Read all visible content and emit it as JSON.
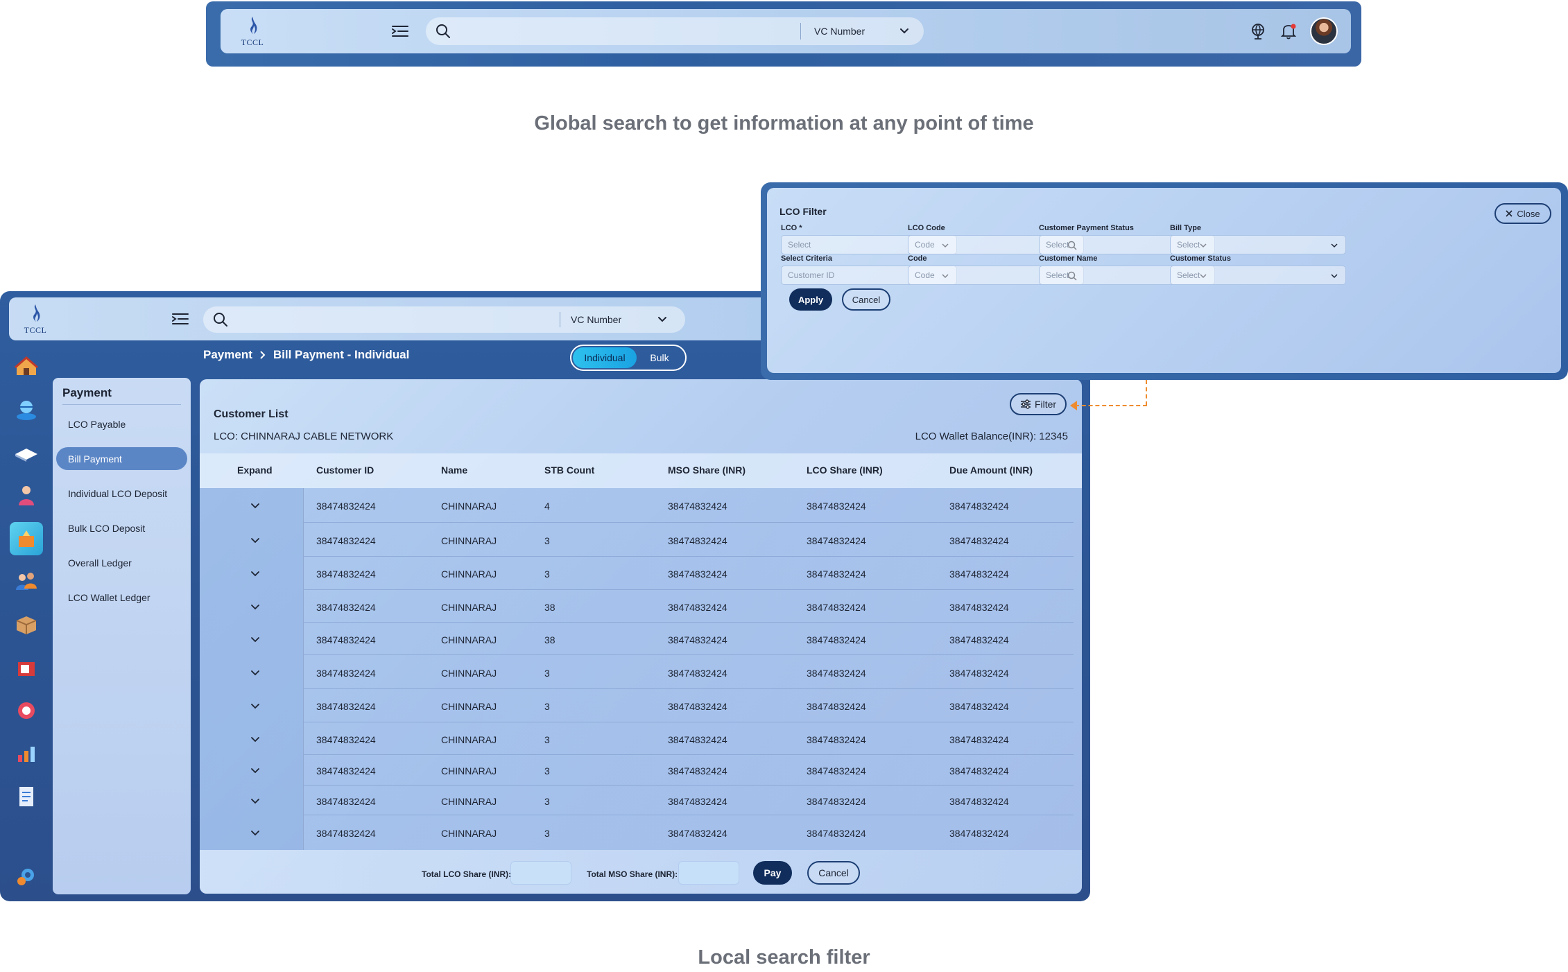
{
  "top_bar": {
    "logo_text": "TCCL",
    "search_placeholder": "",
    "search_type": "VC Number"
  },
  "captions": {
    "global": "Global search to get information at any point of time",
    "local": "Local search filter"
  },
  "app": {
    "logo_text": "TCCL",
    "search_type": "VC Number",
    "breadcrumb": {
      "parent": "Payment",
      "current": "Bill Payment - Individual"
    },
    "toggle": {
      "individual": "Individual",
      "bulk": "Bulk"
    },
    "sidebar": {
      "title": "Payment",
      "items": [
        {
          "label": "LCO Payable"
        },
        {
          "label": "Bill Payment"
        },
        {
          "label": "Individual LCO Deposit"
        },
        {
          "label": "Bulk LCO Deposit"
        },
        {
          "label": "Overall Ledger"
        },
        {
          "label": "LCO Wallet Ledger"
        }
      ]
    },
    "customer_list": {
      "title": "Customer List",
      "lco_label": "LCO: CHINNARAJ CABLE NETWORK",
      "wallet_balance": "LCO Wallet Balance(INR): 12345",
      "filter_label": "Filter",
      "columns": [
        "Expand",
        "Customer ID",
        "Name",
        "STB Count",
        "MSO Share (INR)",
        "LCO Share (INR)",
        "Due Amount (INR)"
      ],
      "rows": [
        {
          "id": "38474832424",
          "name": "CHINNARAJ",
          "stb": "4",
          "mso": "38474832424",
          "lco": "38474832424",
          "due": "38474832424"
        },
        {
          "id": "38474832424",
          "name": "CHINNARAJ",
          "stb": "3",
          "mso": "38474832424",
          "lco": "38474832424",
          "due": "38474832424"
        },
        {
          "id": "38474832424",
          "name": "CHINNARAJ",
          "stb": "3",
          "mso": "38474832424",
          "lco": "38474832424",
          "due": "38474832424"
        },
        {
          "id": "38474832424",
          "name": "CHINNARAJ",
          "stb": "38",
          "mso": "38474832424",
          "lco": "38474832424",
          "due": "38474832424"
        },
        {
          "id": "38474832424",
          "name": "CHINNARAJ",
          "stb": "38",
          "mso": "38474832424",
          "lco": "38474832424",
          "due": "38474832424"
        },
        {
          "id": "38474832424",
          "name": "CHINNARAJ",
          "stb": "3",
          "mso": "38474832424",
          "lco": "38474832424",
          "due": "38474832424"
        },
        {
          "id": "38474832424",
          "name": "CHINNARAJ",
          "stb": "3",
          "mso": "38474832424",
          "lco": "38474832424",
          "due": "38474832424"
        },
        {
          "id": "38474832424",
          "name": "CHINNARAJ",
          "stb": "3",
          "mso": "38474832424",
          "lco": "38474832424",
          "due": "38474832424"
        },
        {
          "id": "38474832424",
          "name": "CHINNARAJ",
          "stb": "3",
          "mso": "38474832424",
          "lco": "38474832424",
          "due": "38474832424"
        },
        {
          "id": "38474832424",
          "name": "CHINNARAJ",
          "stb": "3",
          "mso": "38474832424",
          "lco": "38474832424",
          "due": "38474832424"
        },
        {
          "id": "38474832424",
          "name": "CHINNARAJ",
          "stb": "3",
          "mso": "38474832424",
          "lco": "38474832424",
          "due": "38474832424"
        }
      ],
      "footer": {
        "total_lco_label": "Total LCO Share (INR):",
        "total_lco_value": "",
        "total_mso_label": "Total MSO Share (INR):",
        "total_mso_value": "",
        "pay_label": "Pay",
        "cancel_label": "Cancel"
      }
    }
  },
  "lco_filter": {
    "title": "LCO Filter",
    "close_label": "Close",
    "fields": [
      {
        "label": "LCO *",
        "placeholder": "Select",
        "kind": "select"
      },
      {
        "label": "LCO Code",
        "placeholder": "Code",
        "kind": "search"
      },
      {
        "label": "Customer Payment Status",
        "placeholder": "Select",
        "kind": "select"
      },
      {
        "label": "Bill Type",
        "placeholder": "Select",
        "kind": "select"
      },
      {
        "label": "Select Criteria",
        "placeholder": "Customer ID",
        "kind": "select"
      },
      {
        "label": "Code",
        "placeholder": "Code",
        "kind": "search"
      },
      {
        "label": "Customer Name",
        "placeholder": "Select",
        "kind": "select"
      },
      {
        "label": "Customer Status",
        "placeholder": "Select",
        "kind": "select"
      }
    ],
    "apply_label": "Apply",
    "cancel_label": "Cancel"
  },
  "colors": {
    "frame_blue": "#2f5fa0",
    "accent_cyan": "#1aa2e2",
    "dark_button": "#102d5c",
    "connector_orange": "#ee8c2f"
  },
  "rail_icons": [
    "house-icon",
    "globe-stack-icon",
    "card-icon",
    "person-icon",
    "payment-box-icon",
    "users-icon",
    "package-icon",
    "tv-icon",
    "support-icon",
    "chart-icon",
    "document-icon",
    "settings-icon"
  ]
}
